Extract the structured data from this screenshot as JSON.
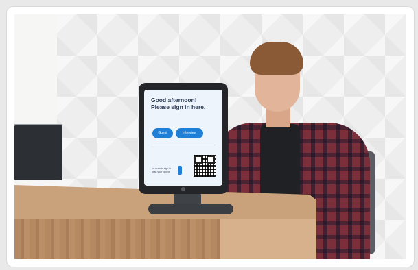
{
  "kiosk": {
    "greeting_line1": "Good afternoon!",
    "greeting_line2": "Please sign in here.",
    "guest_button": "Guest",
    "interview_button": "Interview",
    "qr_hint": "or scan to sign in with your phone"
  },
  "colors": {
    "button_blue": "#1f7fd6",
    "screen_bg": "#eef4fb",
    "desk_wood": "#c9a27b"
  },
  "icons": [
    "qr-code-icon",
    "phone-icon",
    "camera-icon"
  ]
}
